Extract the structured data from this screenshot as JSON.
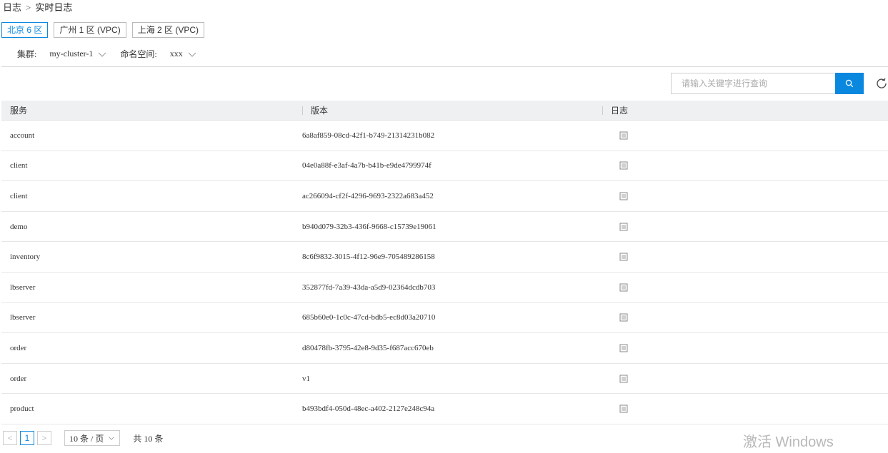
{
  "breadcrumb": {
    "parent": "日志",
    "separator": ">",
    "current": "实时日志"
  },
  "regions": [
    {
      "label": "北京 6 区",
      "active": true
    },
    {
      "label": "广州 1 区 (VPC)",
      "active": false
    },
    {
      "label": "上海 2 区 (VPC)",
      "active": false
    }
  ],
  "filters": {
    "cluster_label": "集群:",
    "cluster_value": "my-cluster-1",
    "namespace_label": "命名空间:",
    "namespace_value": "xxx"
  },
  "search": {
    "placeholder": "请输入关键字进行查询"
  },
  "table": {
    "headers": {
      "service": "服务",
      "version": "版本",
      "log": "日志"
    },
    "rows": [
      {
        "service": "account",
        "version": "6a8af859-08cd-42f1-b749-21314231b082"
      },
      {
        "service": "client",
        "version": "04e0a88f-e3af-4a7b-b41b-e9de4799974f"
      },
      {
        "service": "client",
        "version": "ac266094-cf2f-4296-9693-2322a683a452"
      },
      {
        "service": "demo",
        "version": "b940d079-32b3-436f-9668-c15739e19061"
      },
      {
        "service": "inventory",
        "version": "8c6f9832-3015-4f12-96e9-705489286158"
      },
      {
        "service": "lbserver",
        "version": "352877fd-7a39-43da-a5d9-02364dcdb703"
      },
      {
        "service": "lbserver",
        "version": "685b60e0-1c0c-47cd-bdb5-ec8d03a20710"
      },
      {
        "service": "order",
        "version": "d80478fb-3795-42e8-9d35-f687acc670eb"
      },
      {
        "service": "order",
        "version": "v1"
      },
      {
        "service": "product",
        "version": "b493bdf4-050d-48ec-a402-2127e248c94a"
      }
    ]
  },
  "pagination": {
    "prev": "<",
    "current_page": "1",
    "next": ">",
    "page_size": "10 条 / 页",
    "total": "共 10 条"
  },
  "watermark": "激活 Windows",
  "colors": {
    "accent": "#0a88e0",
    "header_bg": "#eef0f2"
  }
}
